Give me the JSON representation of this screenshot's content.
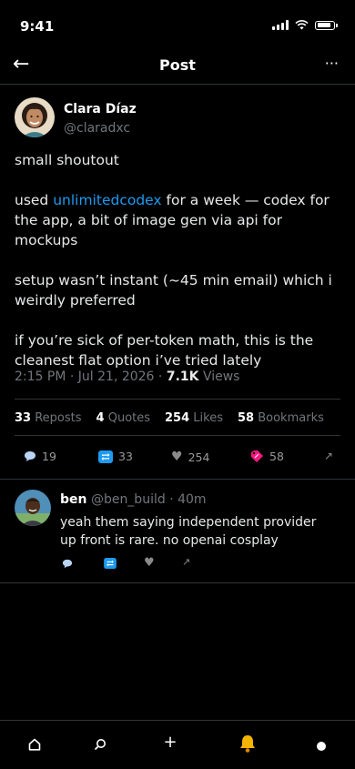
{
  "status": {
    "time": "9:41",
    "battery_level": 0.9
  },
  "nav": {
    "title": "Post",
    "back_icon": "arrow-left-icon",
    "more_icon": "more-horizontal-icon"
  },
  "post": {
    "author": {
      "name": "Clara Díaz",
      "handle": "@claradxc"
    },
    "paragraphs": [
      {
        "text": "small shoutout"
      },
      {
        "before": "used ",
        "link": "unlimitedcodex",
        "after": " for a week — codex for the app, a bit of image gen via api for mockups"
      },
      {
        "text": "setup wasn’t instant (~45 min email) which i weirdly preferred"
      },
      {
        "text": "if you’re sick of per-token math, this is the cleanest flat option i’ve tried lately"
      }
    ],
    "meta": {
      "time": "2:15 PM",
      "sep1": "·",
      "date": "Jul 21, 2026",
      "sep2": "·",
      "views_count": "7.1K",
      "views_label": "Views"
    },
    "stats": {
      "reposts_count": "33",
      "reposts_label": "Reposts",
      "quotes_count": "4",
      "quotes_label": "Quotes",
      "likes_count": "254",
      "likes_label": "Likes",
      "bookmarks_count": "58",
      "bookmarks_label": "Bookmarks"
    },
    "actions": {
      "replies": "19",
      "reposts": "33",
      "likes": "254",
      "bookmarks": "58"
    }
  },
  "reply": {
    "name": "ben",
    "handle": "@ben_build",
    "sep": "·",
    "time": "40m",
    "text": "yeah them saying independent provider up front is rare. no openai cosplay"
  },
  "colors": {
    "link": "#1d9bf0",
    "muted": "#71767b",
    "background": "#000000",
    "repost": "#1d9bf0",
    "bookmark": "#f91880"
  },
  "tabbar": {
    "icons": [
      "home-icon",
      "search-icon",
      "plus-icon",
      "bell-icon",
      "profile-icon"
    ]
  }
}
